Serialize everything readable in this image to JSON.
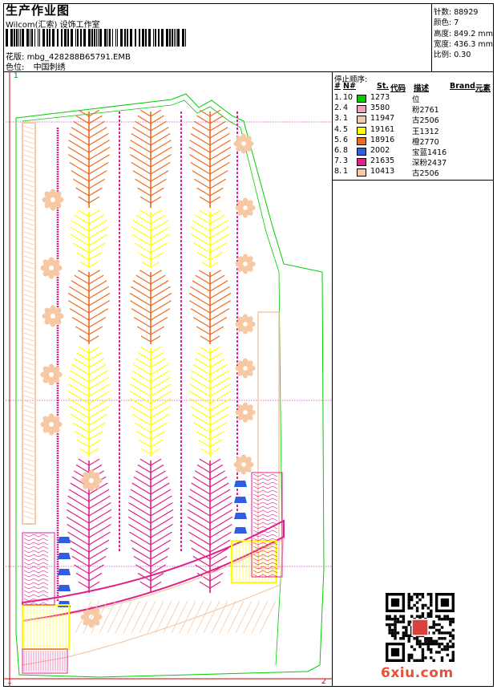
{
  "header": {
    "title": "生产作业图",
    "company": "Wilcom(汇索) 设饰工作室",
    "design_label": "花版:",
    "design_value": "mbg_428288B65791.EMB",
    "colorway_label": "色位:",
    "colorway_value": "中国刺绣"
  },
  "stats": {
    "stitches": "针数: 88929",
    "colors": "颜色: 7",
    "height": "高度: 849.2 mm",
    "width": "宽度: 436.3 mm",
    "scale": "比例: 0.30"
  },
  "sequence": {
    "title": "停止顺序:",
    "headers": {
      "hash": "#",
      "n": "N#",
      "st": "St.",
      "code": "代码",
      "desc": "描述",
      "brand": "Brand",
      "elem": "元素"
    },
    "rows": [
      {
        "idx": "1.",
        "n": "10",
        "st": "1273",
        "desc": "位",
        "color": "#00cc00"
      },
      {
        "idx": "2.",
        "n": "4",
        "st": "3580",
        "desc": "粉2761",
        "color": "#f3a0b8"
      },
      {
        "idx": "3.",
        "n": "1",
        "st": "11947",
        "desc": "古2506",
        "color": "#f6c8a4"
      },
      {
        "idx": "4.",
        "n": "5",
        "st": "19161",
        "desc": "王1312",
        "color": "#ffff00"
      },
      {
        "idx": "5.",
        "n": "6",
        "st": "18916",
        "desc": "橙2770",
        "color": "#ee6a1c"
      },
      {
        "idx": "6.",
        "n": "8",
        "st": "2002",
        "desc": "宝蓝1416",
        "color": "#2f5fe0"
      },
      {
        "idx": "7.",
        "n": "3",
        "st": "21635",
        "desc": "深粉2437",
        "color": "#e0208c"
      },
      {
        "idx": "8.",
        "n": "1",
        "st": "10413",
        "desc": "古2506",
        "color": "#f6c8a4"
      }
    ]
  },
  "colors": {
    "outline": "#00cc00",
    "grid": "#c040c0",
    "frame_red": "#cc0000",
    "branch_orange": "#ee6a1c",
    "branch_yellow": "#ffff00",
    "branch_magenta": "#e0208c",
    "flower": "#f6c8a4",
    "blue": "#2f5fe0"
  },
  "corners": {
    "top_left": "1",
    "bottom_left": "1",
    "bottom_right": "2"
  },
  "watermark": "6xiu.com"
}
